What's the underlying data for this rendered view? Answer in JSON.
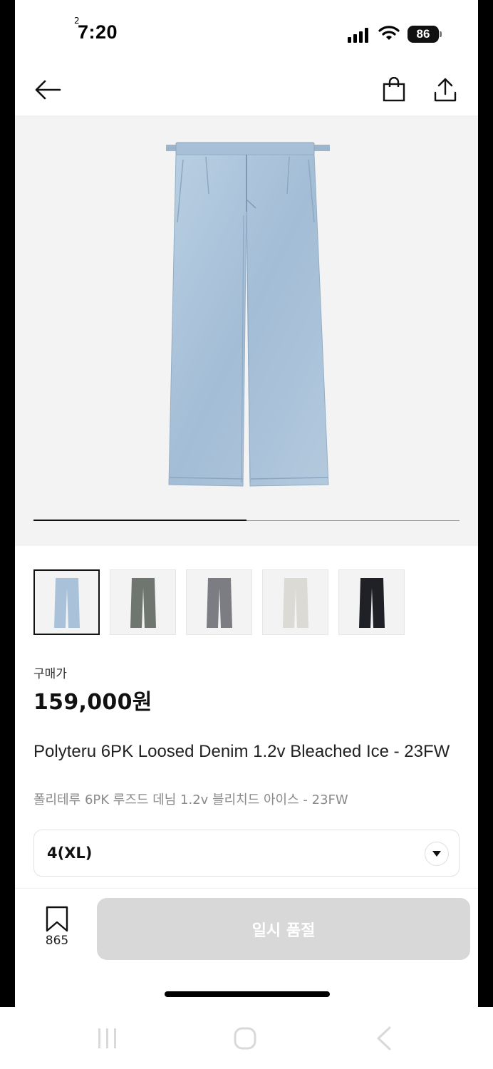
{
  "status_bar": {
    "time": "7:20",
    "time_badge": "2",
    "battery": "86"
  },
  "nav": {
    "back_icon": "arrow-left-icon",
    "bag_icon": "shopping-bag-icon",
    "share_icon": "share-icon"
  },
  "gallery": {
    "image_index_progress": 0.5,
    "thumbnail_colors": [
      "#a9c2d9",
      "#6f766f",
      "#7b7d82",
      "#dcdad4",
      "#1f2126"
    ],
    "selected_thumbnail": 0
  },
  "product": {
    "price_label": "구매가",
    "price": "159,000원",
    "title": "Polyteru 6PK Loosed Denim 1.2v Bleached Ice - 23FW",
    "subtitle": "폴리테루 6PK 루즈드 데님 1.2v 블리치드 아이스 - 23FW"
  },
  "size_select": {
    "value": "4(XL)",
    "icon": "chevron-down-icon"
  },
  "bottom_bar": {
    "bookmark_icon": "bookmark-icon",
    "bookmark_count": "865",
    "action_label": "일시 품절"
  },
  "android_nav": {
    "recents_icon": "recents-icon",
    "home_icon": "home-icon",
    "back_icon": "back-chevron-icon"
  },
  "colors": {
    "sold_out_button": "#d8d8d8",
    "hero_background": "#f3f3f3",
    "denim": "#a9c2d9"
  }
}
